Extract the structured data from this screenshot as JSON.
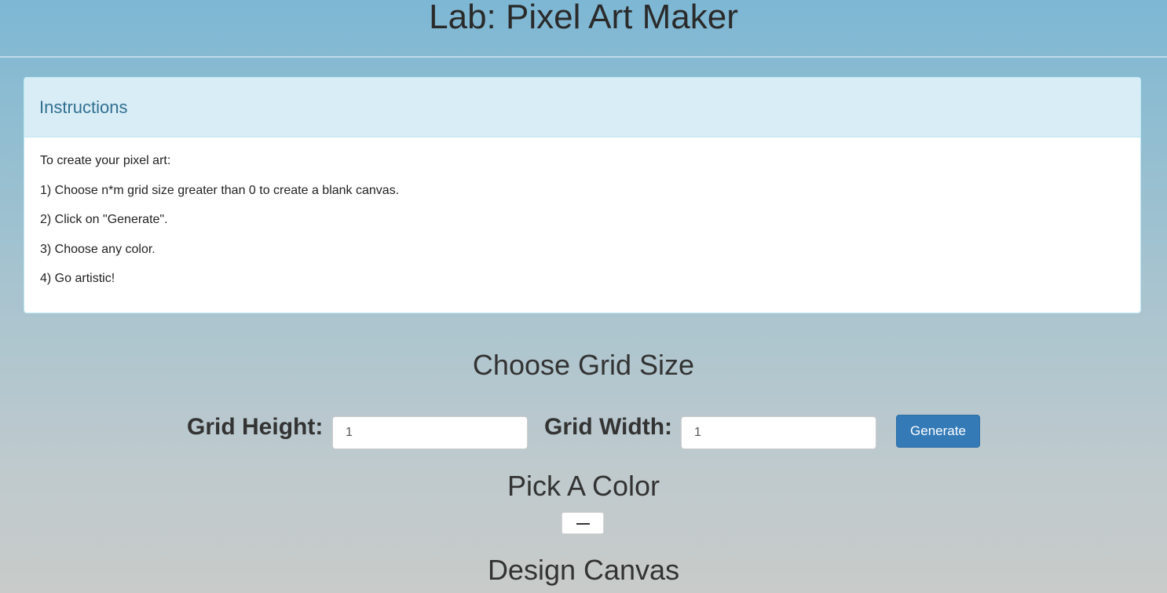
{
  "header": {
    "title": "Lab: Pixel Art Maker"
  },
  "instructions": {
    "heading": "Instructions",
    "lines": [
      "To create your pixel art:",
      "1) Choose n*m grid size greater than 0 to create a blank canvas.",
      "2) Click on \"Generate\".",
      "3) Choose any color.",
      "4) Go artistic!"
    ]
  },
  "grid_size": {
    "title": "Choose Grid Size",
    "height_label": "Grid Height:",
    "height_value": "1",
    "width_label": "Grid Width:",
    "width_value": "1",
    "generate_label": "Generate"
  },
  "color": {
    "title": "Pick A Color",
    "value": "#000000"
  },
  "canvas": {
    "title": "Design Canvas"
  },
  "colors": {
    "primary_button": "#337ab7",
    "panel_heading_bg": "#d9edf7",
    "panel_heading_text": "#31708f"
  }
}
